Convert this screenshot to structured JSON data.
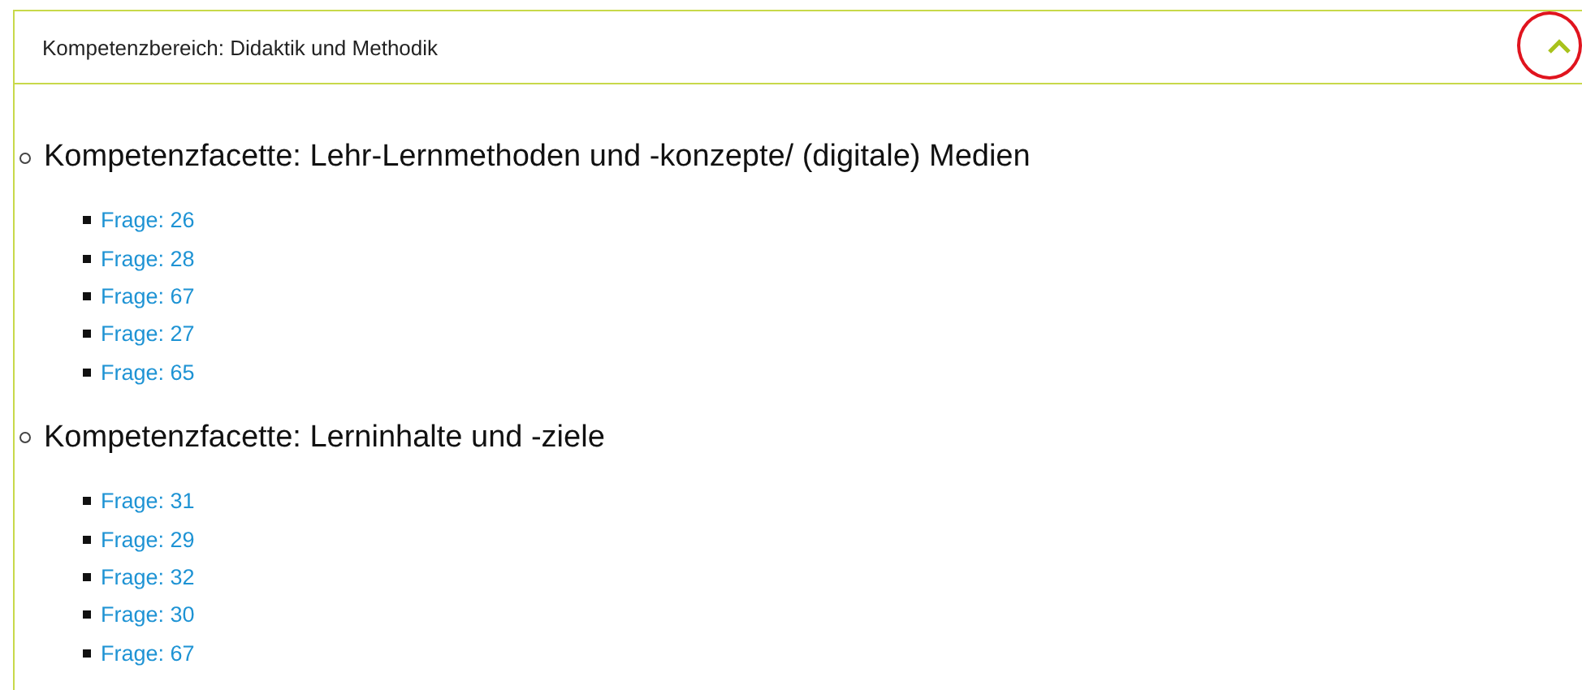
{
  "section": {
    "title": "Kompetenzbereich: Didaktik und Methodik",
    "expanded": true,
    "facets": [
      {
        "title": "Kompetenzfacette: Lehr-Lernmethoden und -konzepte/ (digitale) Medien",
        "questions": [
          "Frage: 26",
          "Frage: 28",
          "Frage: 67",
          "Frage: 27",
          "Frage: 65"
        ]
      },
      {
        "title": "Kompetenzfacette: Lerninhalte und -ziele",
        "questions": [
          "Frage: 31",
          "Frage: 29",
          "Frage: 32",
          "Frage: 30",
          "Frage: 67"
        ]
      }
    ]
  }
}
